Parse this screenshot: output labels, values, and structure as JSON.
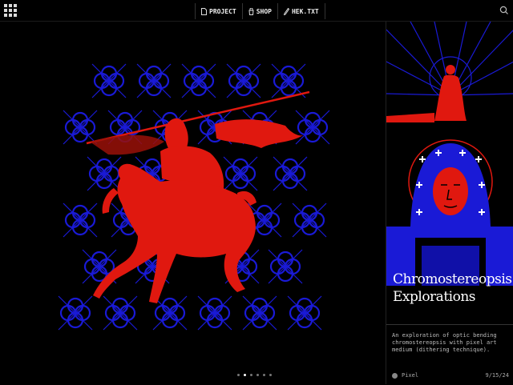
{
  "nav": {
    "items": [
      {
        "label": "PROJECT",
        "icon": "file-icon"
      },
      {
        "label": "SHOP",
        "icon": "shop-icon"
      },
      {
        "label": "HEK.TXT",
        "icon": "pen-icon"
      }
    ]
  },
  "project": {
    "title_line1": "Chromostereopsis",
    "title_line2": "Explorations",
    "description": "An exploration of optic bending chromostereopsis with pixel art medium (dithering technique).",
    "category": "Pixel",
    "date": "9/15/24"
  },
  "carousel": {
    "slide_count": 6,
    "active_index": 1
  },
  "colors": {
    "accent_red": "#e0180f",
    "pattern_blue": "#1a1ad6",
    "background": "#000000"
  }
}
